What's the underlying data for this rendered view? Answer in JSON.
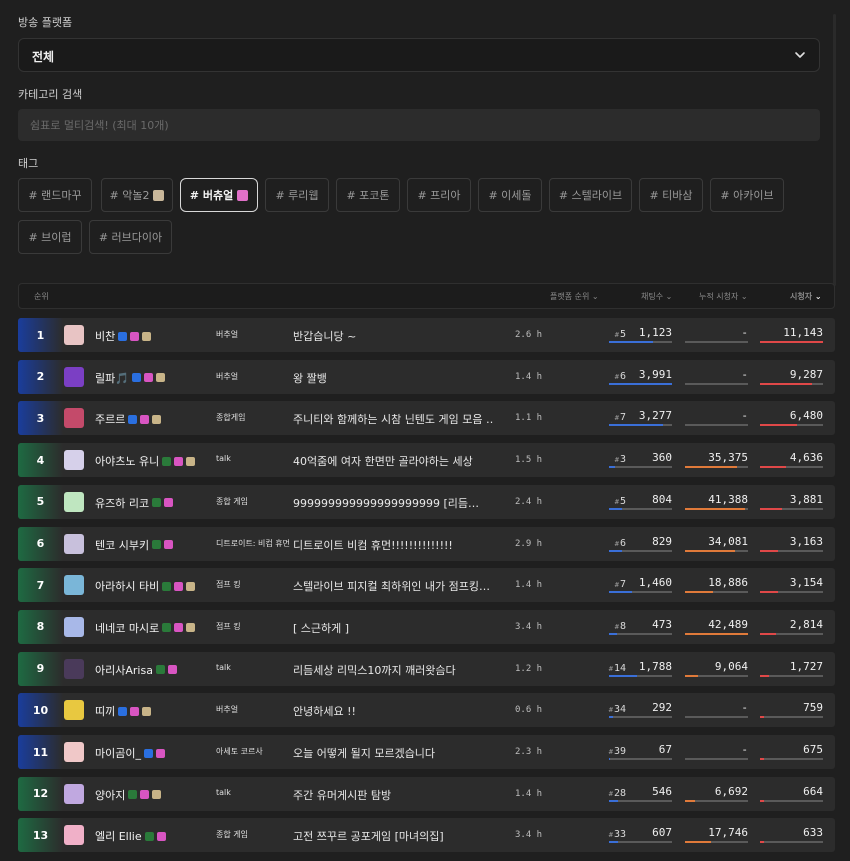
{
  "platform": {
    "label": "방송 플랫폼",
    "value": "전체"
  },
  "category": {
    "label": "카테고리 검색",
    "placeholder": "쉼표로 멀티검색! (최대 10개)"
  },
  "tags": {
    "label": "태그",
    "items": [
      {
        "text": "# 랜드마꾸",
        "emoji": null
      },
      {
        "text": "# 악놀2",
        "emoji": "#c9b79a"
      },
      {
        "text": "# 버츄얼",
        "emoji": "#e070c8",
        "active": true
      },
      {
        "text": "# 루리웹",
        "emoji": null
      },
      {
        "text": "# 포코톤",
        "emoji": null
      },
      {
        "text": "# 프리아",
        "emoji": null
      },
      {
        "text": "# 이세돌",
        "emoji": null
      },
      {
        "text": "# 스텔라이브",
        "emoji": null
      },
      {
        "text": "# 티바삼",
        "emoji": null
      },
      {
        "text": "# 아카이브",
        "emoji": null
      },
      {
        "text": "# 브이럽",
        "emoji": null
      },
      {
        "text": "# 러브다이아",
        "emoji": null
      }
    ]
  },
  "table": {
    "headers": {
      "rank": "순위",
      "platform_rank": "플랫폼 순위",
      "chat": "채팅수",
      "cumulative": "누적 시청자",
      "viewers": "시청자"
    },
    "sort_active": "viewers",
    "rows": [
      {
        "rank": "1",
        "rank_color": "#1a3d9c",
        "avatar": "#e8c4c4",
        "name": "비찬",
        "badges": [
          "#2a6fe0",
          "#d855c2",
          "#c8b488"
        ],
        "category": "버추얼",
        "title": "반갑습니당 ~",
        "duration": "2.6 h",
        "platform_rank": "5",
        "chat": "1,123",
        "chat_level": 0.7,
        "cumulative": "-",
        "cum_level": 0,
        "viewers": "11,143",
        "viewers_level": 1.0
      },
      {
        "rank": "2",
        "rank_color": "#1a3d9c",
        "avatar": "#7b3fc4",
        "name": "릴파🎵",
        "badges": [
          "#2a6fe0",
          "#d855c2",
          "#c8b488"
        ],
        "category": "버추얼",
        "title": "왕 짤뱅",
        "duration": "1.4 h",
        "platform_rank": "6",
        "chat": "3,991",
        "chat_level": 1.0,
        "cumulative": "-",
        "cum_level": 0,
        "viewers": "9,287",
        "viewers_level": 0.83
      },
      {
        "rank": "3",
        "rank_color": "#1a3d9c",
        "avatar": "#c44a6a",
        "name": "주르르",
        "badges": [
          "#2a6fe0",
          "#d855c2",
          "#c8b488"
        ],
        "category": "종합게임",
        "title": "주니티와 함께하는 시참 닌텐도 게임 모음 …",
        "duration": "1.1 h",
        "platform_rank": "7",
        "chat": "3,277",
        "chat_level": 0.85,
        "cumulative": "-",
        "cum_level": 0,
        "viewers": "6,480",
        "viewers_level": 0.58
      },
      {
        "rank": "4",
        "rank_color": "#1e6a42",
        "avatar": "#d6d0ea",
        "name": "아야츠노 유니",
        "badges": [
          "#2a7a3a",
          "#d855c2",
          "#c8b488"
        ],
        "category": "talk",
        "title": "40억줌에 여자 한면만 골라야하는 세상",
        "duration": "1.5 h",
        "platform_rank": "3",
        "chat": "360",
        "chat_level": 0.1,
        "cumulative": "35,375",
        "cum_level": 0.82,
        "viewers": "4,636",
        "viewers_level": 0.42
      },
      {
        "rank": "5",
        "rank_color": "#1e6a42",
        "avatar": "#bfe6c0",
        "name": "유즈하 리코",
        "badges": [
          "#2a7a3a",
          "#d855c2"
        ],
        "category": "종합 게임",
        "title": "999999999999999999999 [리듬…",
        "duration": "2.4 h",
        "platform_rank": "5",
        "chat": "804",
        "chat_level": 0.2,
        "cumulative": "41,388",
        "cum_level": 0.96,
        "viewers": "3,881",
        "viewers_level": 0.35
      },
      {
        "rank": "6",
        "rank_color": "#1e6a42",
        "avatar": "#c8c0dc",
        "name": "텐코 시부키",
        "badges": [
          "#2a7a3a",
          "#d855c2"
        ],
        "category": "디트로이트: 비컴 휴먼",
        "title": "디트로이트 비컴 휴먼!!!!!!!!!!!!!!",
        "duration": "2.9 h",
        "platform_rank": "6",
        "chat": "829",
        "chat_level": 0.21,
        "cumulative": "34,081",
        "cum_level": 0.8,
        "viewers": "3,163",
        "viewers_level": 0.28
      },
      {
        "rank": "7",
        "rank_color": "#1e6a42",
        "avatar": "#7ab6d8",
        "name": "아라하시 타비",
        "badges": [
          "#2a7a3a",
          "#d855c2",
          "#c8b488"
        ],
        "category": "점프 킹",
        "title": "스텔라이브 피지컬 최하위인 내가 점프킹…",
        "duration": "1.4 h",
        "platform_rank": "7",
        "chat": "1,460",
        "chat_level": 0.37,
        "cumulative": "18,886",
        "cum_level": 0.45,
        "viewers": "3,154",
        "viewers_level": 0.28
      },
      {
        "rank": "8",
        "rank_color": "#1e6a42",
        "avatar": "#a8b8e8",
        "name": "네네코 마시로",
        "badges": [
          "#2a7a3a",
          "#d855c2",
          "#c8b488"
        ],
        "category": "점프 킹",
        "title": "[ 스근하게 ]",
        "duration": "3.4 h",
        "platform_rank": "8",
        "chat": "473",
        "chat_level": 0.12,
        "cumulative": "42,489",
        "cum_level": 1.0,
        "viewers": "2,814",
        "viewers_level": 0.25
      },
      {
        "rank": "9",
        "rank_color": "#1e6a42",
        "avatar": "#4a3a5a",
        "name": "아리사Arisa",
        "badges": [
          "#2a7a3a",
          "#d855c2"
        ],
        "category": "talk",
        "title": "리듬세상 리믹스10까지 깨러왓슴다",
        "duration": "1.2 h",
        "platform_rank": "14",
        "chat": "1,788",
        "chat_level": 0.45,
        "cumulative": "9,064",
        "cum_level": 0.21,
        "viewers": "1,727",
        "viewers_level": 0.15
      },
      {
        "rank": "10",
        "rank_color": "#1a3d9c",
        "avatar": "#e8c840",
        "name": "띠끼",
        "badges": [
          "#2a6fe0",
          "#d855c2",
          "#c8b488"
        ],
        "category": "버추얼",
        "title": "안녕하세요 !!",
        "duration": "0.6 h",
        "platform_rank": "34",
        "chat": "292",
        "chat_level": 0.07,
        "cumulative": "-",
        "cum_level": 0,
        "viewers": "759",
        "viewers_level": 0.07
      },
      {
        "rank": "11",
        "rank_color": "#1a3d9c",
        "avatar": "#f0c8c8",
        "name": "마이곰이_",
        "badges": [
          "#2a6fe0",
          "#d855c2"
        ],
        "category": "아세토 코르사",
        "title": "오늘 어떻게 될지 모르겠습니다",
        "duration": "2.3 h",
        "platform_rank": "39",
        "chat": "67",
        "chat_level": 0.02,
        "cumulative": "-",
        "cum_level": 0,
        "viewers": "675",
        "viewers_level": 0.06
      },
      {
        "rank": "12",
        "rank_color": "#1e6a42",
        "avatar": "#c0a8e0",
        "name": "양아지",
        "badges": [
          "#2a7a3a",
          "#d855c2",
          "#c8b488"
        ],
        "category": "talk",
        "title": "주간 유머게시판 탐방",
        "duration": "1.4 h",
        "platform_rank": "28",
        "chat": "546",
        "chat_level": 0.14,
        "cumulative": "6,692",
        "cum_level": 0.16,
        "viewers": "664",
        "viewers_level": 0.06
      },
      {
        "rank": "13",
        "rank_color": "#1e6a42",
        "avatar": "#f0b0c8",
        "name": "엘리 Ellie",
        "badges": [
          "#2a7a3a",
          "#d855c2"
        ],
        "category": "종합 게임",
        "title": "고전 쯔꾸르 공포게임 [마녀의집]",
        "duration": "3.4 h",
        "platform_rank": "33",
        "chat": "607",
        "chat_level": 0.15,
        "cumulative": "17,746",
        "cum_level": 0.42,
        "viewers": "633",
        "viewers_level": 0.06
      }
    ]
  }
}
